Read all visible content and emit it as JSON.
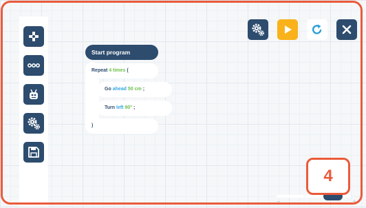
{
  "sidebar": {
    "items": [
      {
        "name": "sidebar-item-controller",
        "icon": "gamepad-icon"
      },
      {
        "name": "sidebar-item-more",
        "icon": "ellipsis-icon"
      },
      {
        "name": "sidebar-item-robot",
        "icon": "robot-icon"
      },
      {
        "name": "sidebar-item-settings",
        "icon": "gears-icon"
      },
      {
        "name": "sidebar-item-save",
        "icon": "save-icon"
      }
    ]
  },
  "toolbar": {
    "buttons": [
      {
        "name": "settings-button",
        "icon": "gears-icon",
        "color": "#2d4c6e"
      },
      {
        "name": "play-button",
        "icon": "play-icon",
        "color": "#f9b21b"
      },
      {
        "name": "reset-button",
        "icon": "refresh-icon",
        "color": "#ffffff"
      },
      {
        "name": "close-button",
        "icon": "close-icon",
        "color": "#2d4c6e"
      }
    ]
  },
  "program": {
    "start": "Start program",
    "repeat": {
      "keyword": "Repeat",
      "count": "4",
      "unit": "times",
      "open": "("
    },
    "go": {
      "keyword": "Go",
      "direction": "ahead",
      "amount": "50 cm",
      "end": ";"
    },
    "turn": {
      "keyword": "Turn",
      "direction": "left",
      "amount": "90°",
      "end": ";"
    },
    "close": ")"
  },
  "step_badge": "4",
  "zoom": {
    "minus": "−",
    "plus": "+",
    "level_fraction": 0.85
  },
  "colors": {
    "accent": "#ea5a3b",
    "primary": "#2d4c6e",
    "play": "#f9b21b",
    "value_green": "#6cc24a",
    "value_blue": "#35a7e0"
  }
}
